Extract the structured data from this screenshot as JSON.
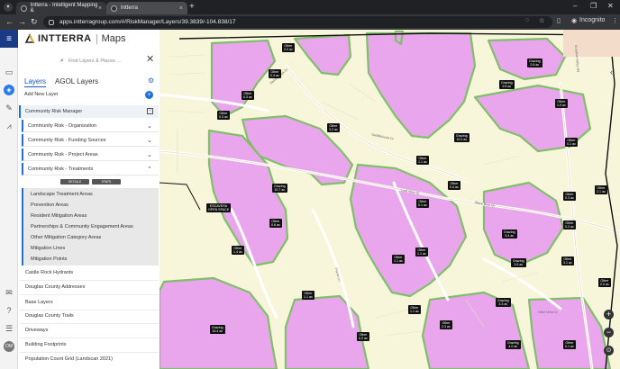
{
  "browser": {
    "tabs": [
      {
        "title": "Intterra - Intelligent Mapping &"
      },
      {
        "title": "Intterra"
      }
    ],
    "url": "apps.intterragroup.com/#/RiskManager/Layers/39.3839/-104.838/17",
    "incognito_label": "Incognito"
  },
  "app": {
    "brand": "INTTERRA",
    "brand_sub": "Maps",
    "search_placeholder": "Find Layers & Places ...",
    "tabs": [
      {
        "label": "Layers"
      },
      {
        "label": "AGOL Layers"
      }
    ],
    "add_new_layer": "Add New Layer",
    "community_risk_manager": "Community Risk Manager",
    "risk_groups": [
      {
        "label": "Community Risk - Organization"
      },
      {
        "label": "Community Risk - Funding Sources"
      },
      {
        "label": "Community Risk - Project Areas"
      },
      {
        "label": "Community Risk - Treatments"
      }
    ],
    "treatment_buttons": [
      "DETAILS",
      "STATS"
    ],
    "treatment_layers": [
      {
        "label": "Landscape Treatment Areas"
      },
      {
        "label": "Prevention Areas"
      },
      {
        "label": "Resident Mitigation Areas"
      },
      {
        "label": "Partnerships & Community Engagement Areas"
      },
      {
        "label": "Other Mitigation Category Areas"
      },
      {
        "label": "Mitigation Lines"
      },
      {
        "label": "Mitigation Points"
      }
    ],
    "layer_groups": [
      {
        "label": "Castle Rock Hydrants"
      },
      {
        "label": "Douglas County Addresses"
      },
      {
        "label": "Base Layers"
      },
      {
        "label": "Douglas County Trails"
      },
      {
        "label": "Driveways"
      },
      {
        "label": "Building Footprints"
      },
      {
        "label": "Population Count Grid (Landscan 2021)"
      }
    ],
    "rail_avatar": "OM"
  },
  "map": {
    "labels": [
      {
        "l1": "Other",
        "l2": "2.0 ac"
      },
      {
        "l1": "Other",
        "l2": "0.4 ac"
      },
      {
        "l1": "Other",
        "l2": "0.3 ac"
      },
      {
        "l1": "Other",
        "l2": "0.3 ac"
      },
      {
        "l1": "Other",
        "l2": "3.2 ac"
      },
      {
        "l1": "Grazing",
        "l2": "2.6 ac"
      },
      {
        "l1": "Grazing",
        "l2": "9.5 ac"
      },
      {
        "l1": "Other",
        "l2": "1.9 ac"
      },
      {
        "l1": "Grazing",
        "l2": "10.0 ac"
      },
      {
        "l1": "Other",
        "l2": "0.1 ac"
      },
      {
        "l1": "Other",
        "l2": "1.1 ac"
      },
      {
        "l1": "Other",
        "l2": "0.4 ac"
      },
      {
        "l1": "Other",
        "l2": "2.1 ac"
      },
      {
        "l1": "Grazing",
        "l2": "10.7 ac"
      },
      {
        "l1": "ESCAVERA",
        "l2": "OPEN SPACE"
      },
      {
        "l1": "Other",
        "l2": "0.1 ac"
      },
      {
        "l1": "Other",
        "l2": "0.3 ac"
      },
      {
        "l1": "Other",
        "l2": "0.6 ac"
      },
      {
        "l1": "Grazing",
        "l2": "5.4 ac"
      },
      {
        "l1": "Other",
        "l2": "0.2 ac"
      },
      {
        "l1": "Other",
        "l2": "1.1 ac"
      },
      {
        "l1": "Other",
        "l2": "1.1 ac"
      },
      {
        "l1": "Grazing",
        "l2": "3.5 ac"
      },
      {
        "l1": "Other",
        "l2": "3.1 ac"
      },
      {
        "l1": "Other",
        "l2": "1.4 ac"
      },
      {
        "l1": "Other",
        "l2": "1.1 ac"
      },
      {
        "l1": "Grazing",
        "l2": "3.3 ac"
      },
      {
        "l1": "Other",
        "l2": "1.1 ac"
      },
      {
        "l1": "Other",
        "l2": "2.3 ac"
      },
      {
        "l1": "Other",
        "l2": "0.2 ac"
      },
      {
        "l1": "Grazing",
        "l2": "16.4 ac"
      },
      {
        "l1": "Grazing",
        "l2": "4.0 ac"
      },
      {
        "l1": "Other",
        "l2": "0.1 ac"
      },
      {
        "l1": "Other",
        "l2": "2.0 ac"
      }
    ],
    "roads": [
      "Saddlebrook Dr",
      "Leaf View Ct",
      "Black Bear Dr",
      "Prairie Ln",
      "Olive View Ct",
      "Crowfoot Valley Rd"
    ]
  },
  "colors": {
    "pink_fill": "#e9a6ec",
    "outline": "#7fbf6a",
    "ground": "#f8f6da",
    "accent": "#1e6fe0"
  }
}
